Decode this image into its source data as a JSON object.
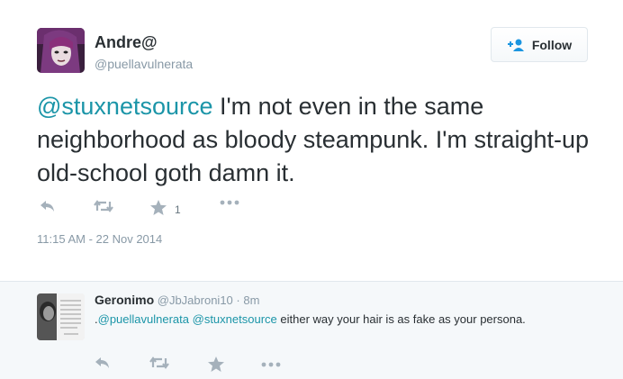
{
  "tweet": {
    "author_name": "Andre@",
    "author_handle": "@puellavulnerata",
    "follow_label": "Follow",
    "mention": "@stuxnetsource",
    "text": " I'm not even in the same neighborhood as bloody steampunk. I'm straight-up old-school goth damn it.",
    "favorite_count": "1",
    "timestamp": "11:15 AM - 22 Nov 2014",
    "icons": [
      "reply-icon",
      "retweet-icon",
      "favorite-icon",
      "more-icon"
    ]
  },
  "reply": {
    "author_name": "Geronimo",
    "author_handle": "@JbJabroni10",
    "separator": "·",
    "age": "8m",
    "prefix": ".",
    "mention_1": "@puellavulnerata",
    "mention_2": "@stuxnetsource",
    "text": " either way your hair is as fake as your persona."
  },
  "colors": {
    "accent": "#1b95a8",
    "muted": "#8899a6",
    "icon": "#a5b1bb",
    "reply_bg": "#f5f8fa"
  }
}
